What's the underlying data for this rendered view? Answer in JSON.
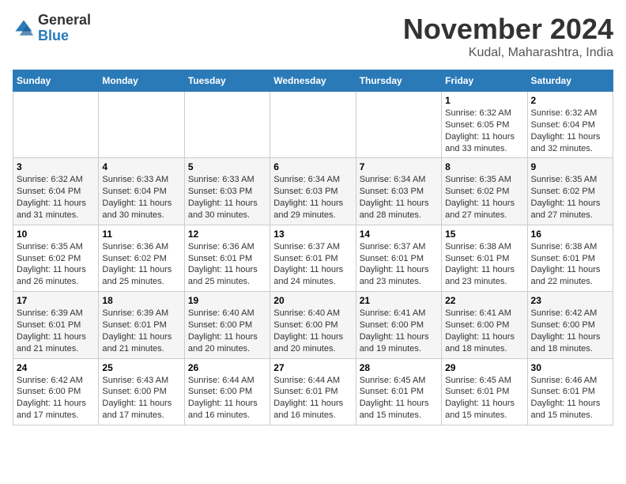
{
  "logo": {
    "general": "General",
    "blue": "Blue"
  },
  "title": "November 2024",
  "location": "Kudal, Maharashtra, India",
  "days_of_week": [
    "Sunday",
    "Monday",
    "Tuesday",
    "Wednesday",
    "Thursday",
    "Friday",
    "Saturday"
  ],
  "weeks": [
    [
      {
        "day": "",
        "info": ""
      },
      {
        "day": "",
        "info": ""
      },
      {
        "day": "",
        "info": ""
      },
      {
        "day": "",
        "info": ""
      },
      {
        "day": "",
        "info": ""
      },
      {
        "day": "1",
        "info": "Sunrise: 6:32 AM\nSunset: 6:05 PM\nDaylight: 11 hours and 33 minutes."
      },
      {
        "day": "2",
        "info": "Sunrise: 6:32 AM\nSunset: 6:04 PM\nDaylight: 11 hours and 32 minutes."
      }
    ],
    [
      {
        "day": "3",
        "info": "Sunrise: 6:32 AM\nSunset: 6:04 PM\nDaylight: 11 hours and 31 minutes."
      },
      {
        "day": "4",
        "info": "Sunrise: 6:33 AM\nSunset: 6:04 PM\nDaylight: 11 hours and 30 minutes."
      },
      {
        "day": "5",
        "info": "Sunrise: 6:33 AM\nSunset: 6:03 PM\nDaylight: 11 hours and 30 minutes."
      },
      {
        "day": "6",
        "info": "Sunrise: 6:34 AM\nSunset: 6:03 PM\nDaylight: 11 hours and 29 minutes."
      },
      {
        "day": "7",
        "info": "Sunrise: 6:34 AM\nSunset: 6:03 PM\nDaylight: 11 hours and 28 minutes."
      },
      {
        "day": "8",
        "info": "Sunrise: 6:35 AM\nSunset: 6:02 PM\nDaylight: 11 hours and 27 minutes."
      },
      {
        "day": "9",
        "info": "Sunrise: 6:35 AM\nSunset: 6:02 PM\nDaylight: 11 hours and 27 minutes."
      }
    ],
    [
      {
        "day": "10",
        "info": "Sunrise: 6:35 AM\nSunset: 6:02 PM\nDaylight: 11 hours and 26 minutes."
      },
      {
        "day": "11",
        "info": "Sunrise: 6:36 AM\nSunset: 6:02 PM\nDaylight: 11 hours and 25 minutes."
      },
      {
        "day": "12",
        "info": "Sunrise: 6:36 AM\nSunset: 6:01 PM\nDaylight: 11 hours and 25 minutes."
      },
      {
        "day": "13",
        "info": "Sunrise: 6:37 AM\nSunset: 6:01 PM\nDaylight: 11 hours and 24 minutes."
      },
      {
        "day": "14",
        "info": "Sunrise: 6:37 AM\nSunset: 6:01 PM\nDaylight: 11 hours and 23 minutes."
      },
      {
        "day": "15",
        "info": "Sunrise: 6:38 AM\nSunset: 6:01 PM\nDaylight: 11 hours and 23 minutes."
      },
      {
        "day": "16",
        "info": "Sunrise: 6:38 AM\nSunset: 6:01 PM\nDaylight: 11 hours and 22 minutes."
      }
    ],
    [
      {
        "day": "17",
        "info": "Sunrise: 6:39 AM\nSunset: 6:01 PM\nDaylight: 11 hours and 21 minutes."
      },
      {
        "day": "18",
        "info": "Sunrise: 6:39 AM\nSunset: 6:01 PM\nDaylight: 11 hours and 21 minutes."
      },
      {
        "day": "19",
        "info": "Sunrise: 6:40 AM\nSunset: 6:00 PM\nDaylight: 11 hours and 20 minutes."
      },
      {
        "day": "20",
        "info": "Sunrise: 6:40 AM\nSunset: 6:00 PM\nDaylight: 11 hours and 20 minutes."
      },
      {
        "day": "21",
        "info": "Sunrise: 6:41 AM\nSunset: 6:00 PM\nDaylight: 11 hours and 19 minutes."
      },
      {
        "day": "22",
        "info": "Sunrise: 6:41 AM\nSunset: 6:00 PM\nDaylight: 11 hours and 18 minutes."
      },
      {
        "day": "23",
        "info": "Sunrise: 6:42 AM\nSunset: 6:00 PM\nDaylight: 11 hours and 18 minutes."
      }
    ],
    [
      {
        "day": "24",
        "info": "Sunrise: 6:42 AM\nSunset: 6:00 PM\nDaylight: 11 hours and 17 minutes."
      },
      {
        "day": "25",
        "info": "Sunrise: 6:43 AM\nSunset: 6:00 PM\nDaylight: 11 hours and 17 minutes."
      },
      {
        "day": "26",
        "info": "Sunrise: 6:44 AM\nSunset: 6:00 PM\nDaylight: 11 hours and 16 minutes."
      },
      {
        "day": "27",
        "info": "Sunrise: 6:44 AM\nSunset: 6:01 PM\nDaylight: 11 hours and 16 minutes."
      },
      {
        "day": "28",
        "info": "Sunrise: 6:45 AM\nSunset: 6:01 PM\nDaylight: 11 hours and 15 minutes."
      },
      {
        "day": "29",
        "info": "Sunrise: 6:45 AM\nSunset: 6:01 PM\nDaylight: 11 hours and 15 minutes."
      },
      {
        "day": "30",
        "info": "Sunrise: 6:46 AM\nSunset: 6:01 PM\nDaylight: 11 hours and 15 minutes."
      }
    ]
  ]
}
